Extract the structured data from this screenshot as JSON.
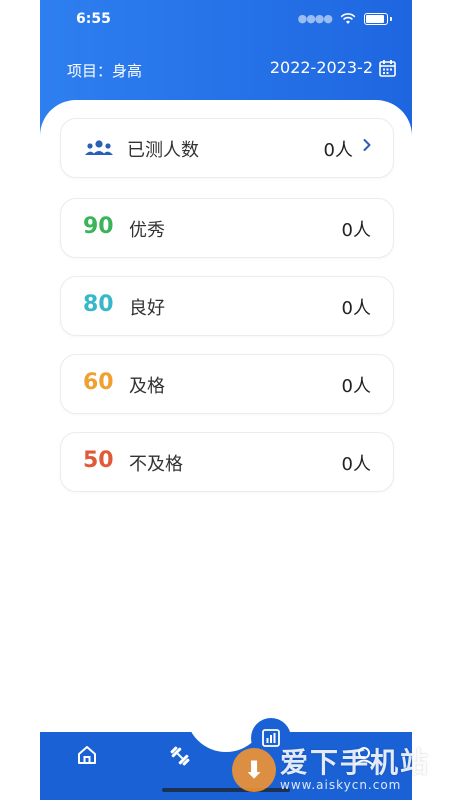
{
  "status_bar": {
    "time": "6:55"
  },
  "header": {
    "project_label": "项目：身高",
    "term": "2022-2023-2"
  },
  "summary": {
    "label": "已测人数",
    "count": "0人"
  },
  "levels": [
    {
      "score": "90",
      "label": "优秀",
      "count": "0人",
      "color": "#3bb35a"
    },
    {
      "score": "80",
      "label": "良好",
      "count": "0人",
      "color": "#37b8c8"
    },
    {
      "score": "60",
      "label": "及格",
      "count": "0人",
      "color": "#f0a030"
    },
    {
      "score": "50",
      "label": "不及格",
      "count": "0人",
      "color": "#e05a3a"
    }
  ],
  "tabbar": {
    "icons": [
      "home-icon",
      "dumbbell-icon",
      "chart-icon",
      "profile-icon"
    ]
  },
  "watermark": {
    "title": "爱下手机站",
    "url": "www.aiskycn.com"
  },
  "colors": {
    "primary": "#1e66e0",
    "icon_blue": "#2a5fb8"
  }
}
